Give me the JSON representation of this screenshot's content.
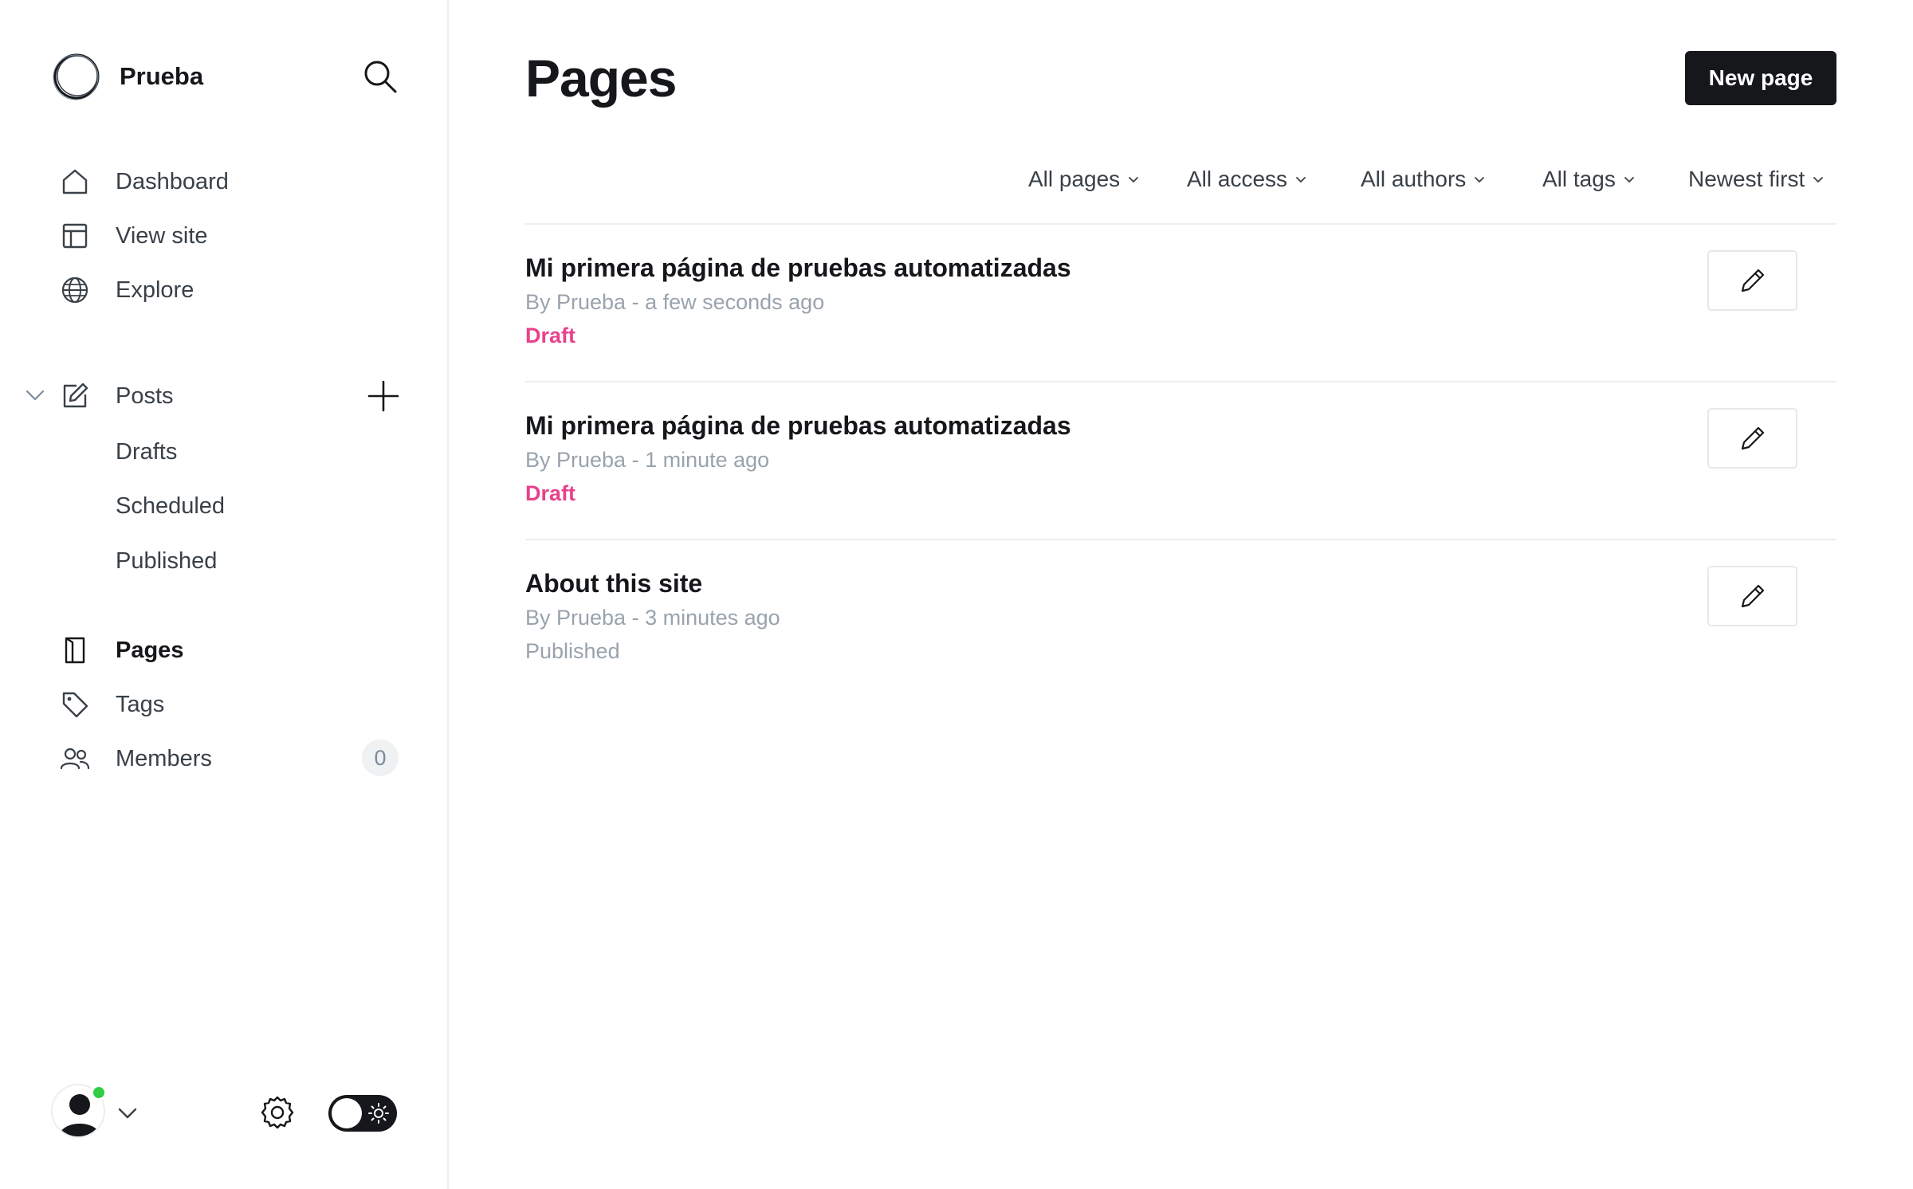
{
  "sidebar": {
    "brand": {
      "name": "Prueba",
      "logo_icon": "site-logo-icon"
    },
    "search_icon": "search-icon",
    "nav": [
      {
        "label": "Dashboard",
        "icon": "home-icon"
      },
      {
        "label": "View site",
        "icon": "layout-icon"
      },
      {
        "label": "Explore",
        "icon": "globe-icon"
      }
    ],
    "posts": {
      "label": "Posts",
      "icon": "edit-icon",
      "expanded": true,
      "sub_items": [
        {
          "label": "Drafts"
        },
        {
          "label": "Scheduled"
        },
        {
          "label": "Published"
        }
      ]
    },
    "nav2": [
      {
        "label": "Pages",
        "icon": "page-icon",
        "active": true
      },
      {
        "label": "Tags",
        "icon": "tag-icon"
      },
      {
        "label": "Members",
        "icon": "members-icon",
        "count": "0"
      }
    ],
    "footer": {
      "user_online": true,
      "online_color": "#30cf43",
      "theme": "dark-toggle-light-mode"
    }
  },
  "main": {
    "title": "Pages",
    "new_button": "New page",
    "filters": [
      {
        "label": "All pages"
      },
      {
        "label": "All access"
      },
      {
        "label": "All authors"
      },
      {
        "label": "All tags"
      },
      {
        "label": "Newest first"
      }
    ],
    "pages": [
      {
        "title": "Mi primera página de pruebas automatizadas",
        "meta": "By Prueba - a few seconds ago",
        "status": "Draft",
        "status_type": "draft"
      },
      {
        "title": "Mi primera página de pruebas automatizadas",
        "meta": "By Prueba - 1 minute ago",
        "status": "Draft",
        "status_type": "draft"
      },
      {
        "title": "About this site",
        "meta": "By Prueba - 3 minutes ago",
        "status": "Published",
        "status_type": "published"
      }
    ]
  },
  "colors": {
    "accent_draft": "#e8418c",
    "primary_button": "#15171a",
    "muted_text": "#99a3ad"
  }
}
